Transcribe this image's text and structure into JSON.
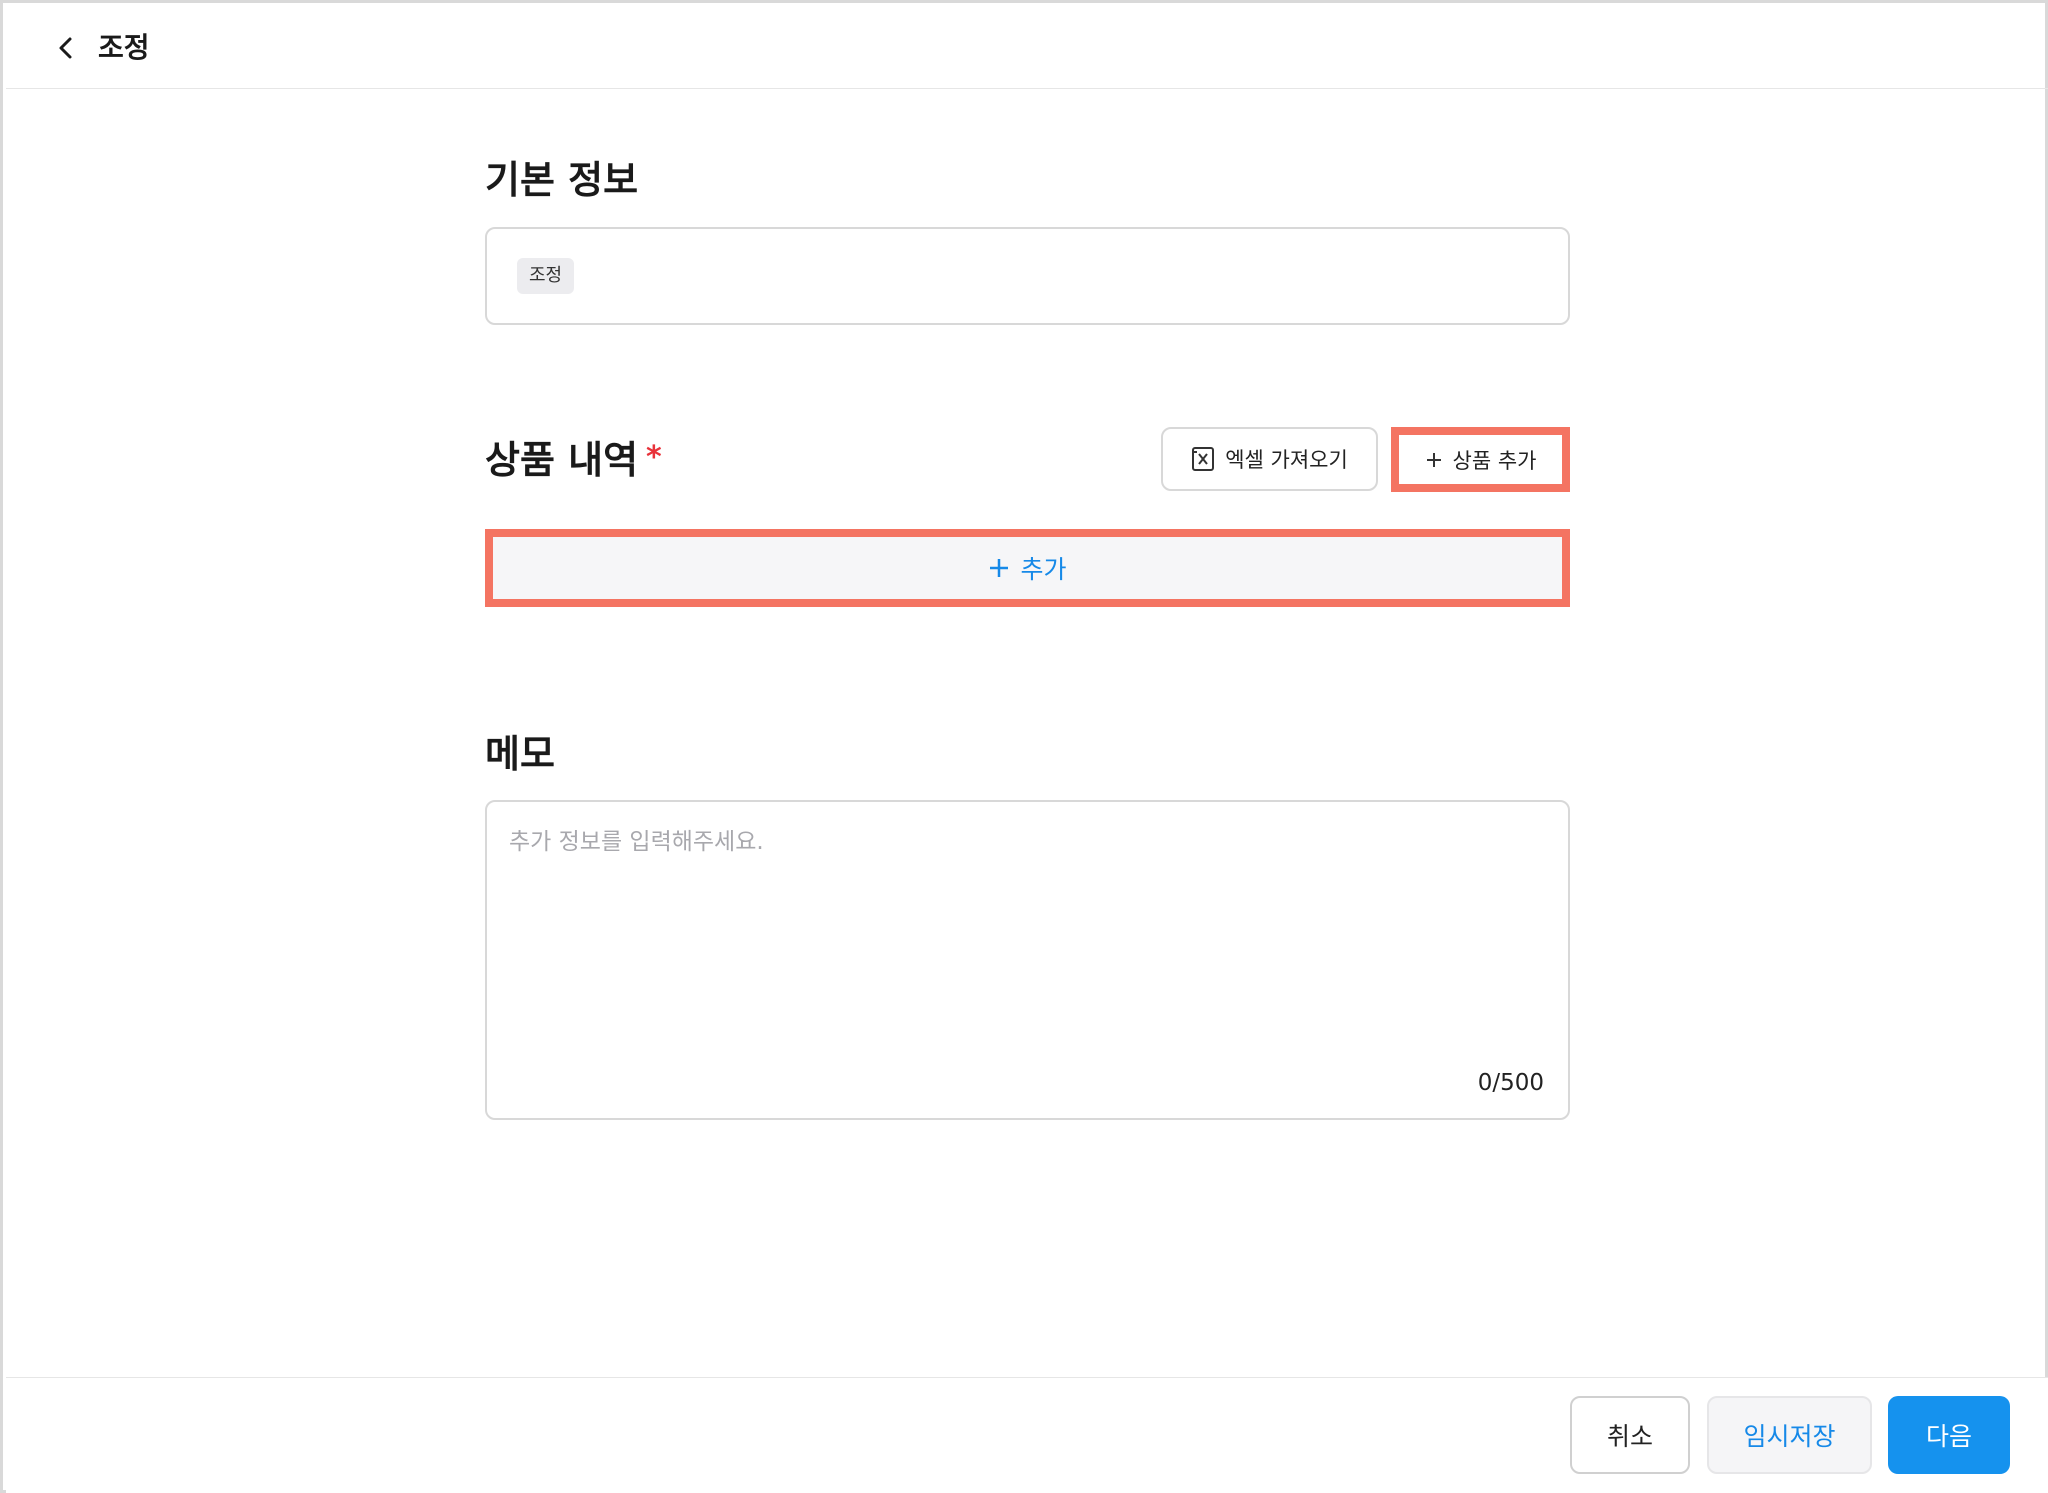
{
  "header": {
    "title": "조정"
  },
  "basic_info": {
    "section_title": "기본 정보",
    "tag": "조정"
  },
  "products": {
    "section_title": "상품 내역",
    "required_mark": "*",
    "excel_import_label": "엑셀 가져오기",
    "add_product_label": "상품 추가",
    "add_row_label": "추가"
  },
  "memo": {
    "section_title": "메모",
    "placeholder": "추가 정보를 입력해주세요.",
    "value": "",
    "char_count": "0/500"
  },
  "footer": {
    "cancel_label": "취소",
    "draft_label": "임시저장",
    "next_label": "다음"
  },
  "colors": {
    "accent": "#1592ee",
    "link": "#1689e8",
    "highlight": "#f47462",
    "required": "#e8323a"
  },
  "icons": {
    "back": "chevron-left-icon",
    "excel": "excel-file-icon",
    "plus": "plus-icon"
  }
}
